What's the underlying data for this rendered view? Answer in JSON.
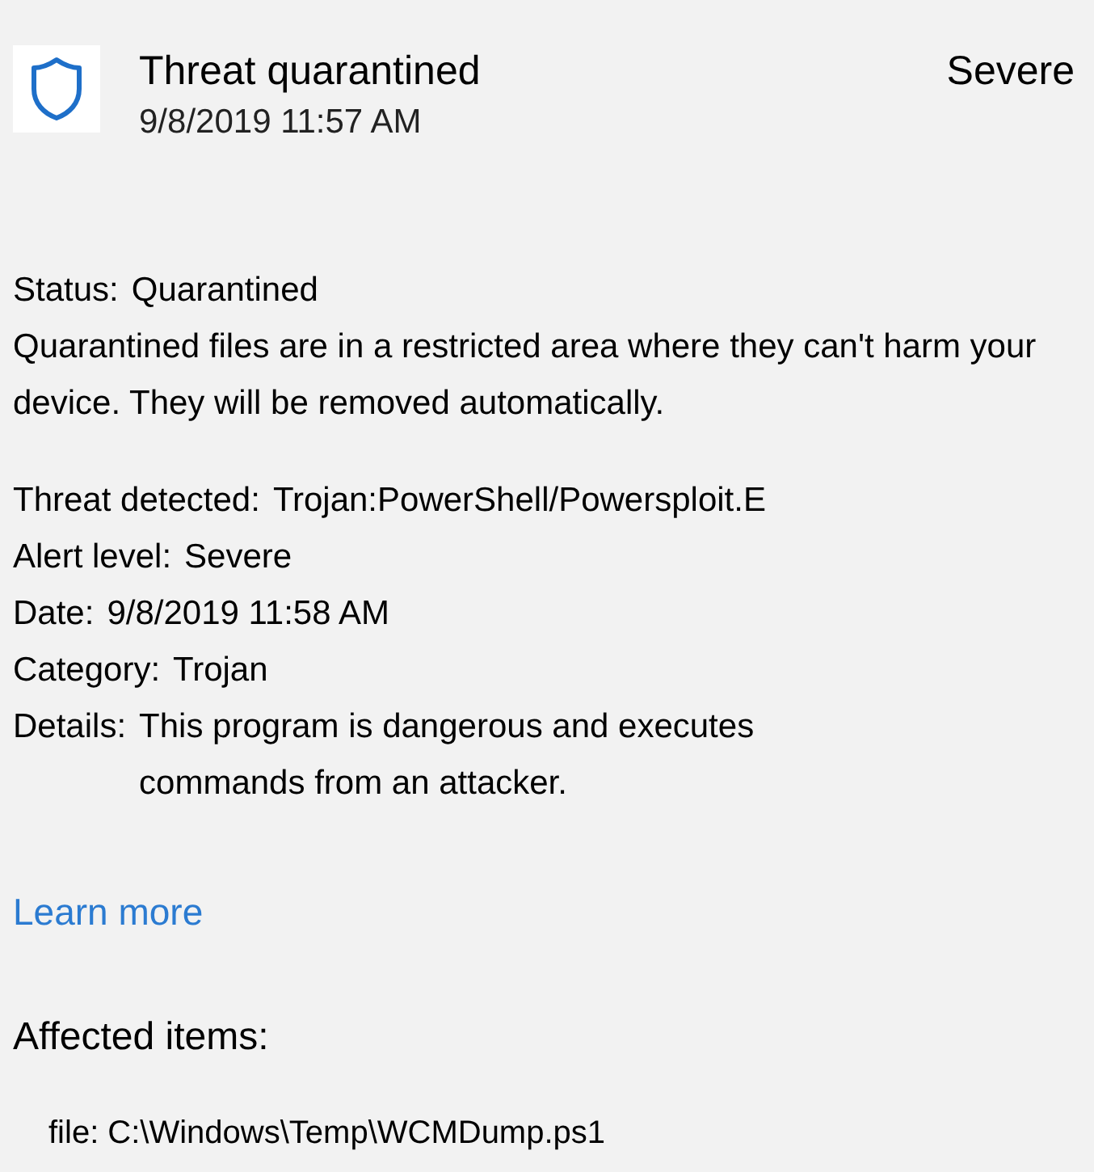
{
  "header": {
    "title": "Threat quarantined",
    "severity": "Severe",
    "datetime": "9/8/2019 11:57 AM"
  },
  "status": {
    "label": "Status:",
    "value": "Quarantined"
  },
  "description": "Quarantined files are in a restricted area where they can't harm your device. They will be removed automatically.",
  "details": [
    {
      "label": "Threat detected:",
      "value": "Trojan:PowerShell/Powersploit.E"
    },
    {
      "label": "Alert level:",
      "value": "Severe"
    },
    {
      "label": "Date:",
      "value": "9/8/2019 11:58 AM"
    },
    {
      "label": "Category:",
      "value": "Trojan"
    },
    {
      "label": "Details:",
      "value": "This program is dangerous and executes commands from an attacker."
    }
  ],
  "link": "Learn more",
  "affected": {
    "heading": "Affected items:",
    "items": [
      "file: C:\\Windows\\Temp\\WCMDump.ps1"
    ]
  }
}
